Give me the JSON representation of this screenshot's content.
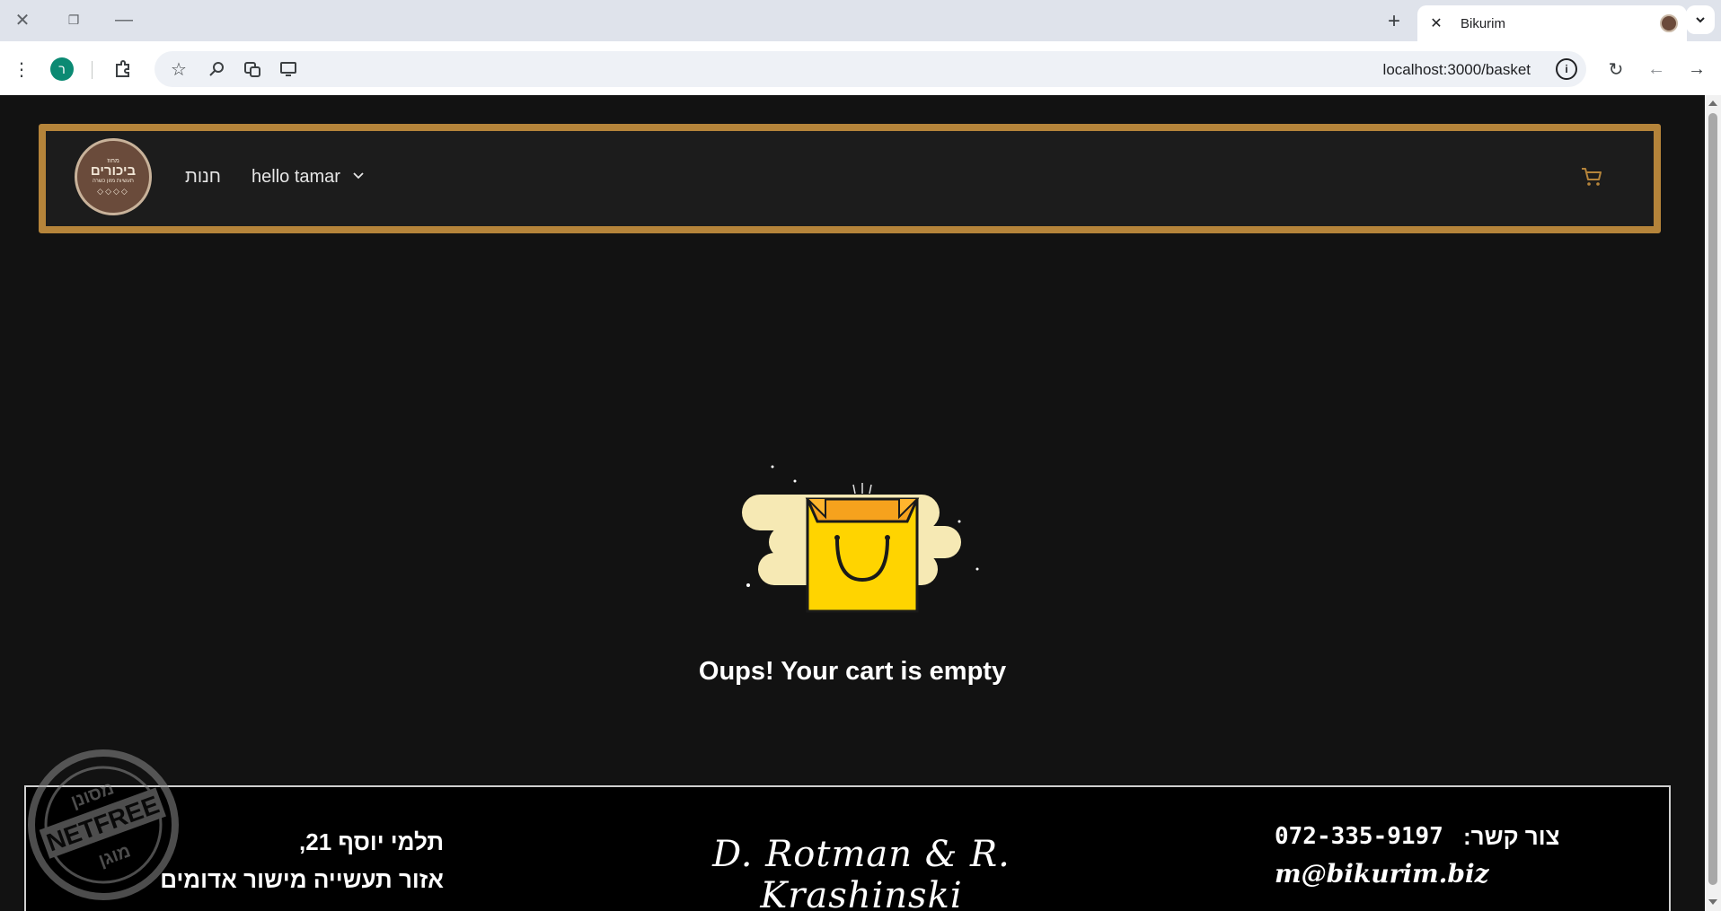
{
  "browser": {
    "tab_title": "Bikurim",
    "url": "localhost:3000/basket",
    "profile_initial": "ר",
    "icons": [
      "close-icon",
      "restore-icon",
      "minimize-icon",
      "new-tab-icon",
      "tab-list-icon",
      "menu-icon",
      "extensions-icon",
      "bookmark-star-icon",
      "zoom-icon",
      "translate-icon",
      "cast-icon",
      "info-icon",
      "reload-icon",
      "back-icon",
      "forward-icon"
    ]
  },
  "navbar": {
    "logo_top": "מחוז",
    "logo_main": "ביכורים",
    "logo_sub": "תעשיות מזון כשרה",
    "logo_symbols": "◇◇◇◇",
    "shop_link": "חנות",
    "user_menu": "hello tamar"
  },
  "main": {
    "empty_message": "Oups! Your cart is empty"
  },
  "watermark": {
    "top": "מסונן",
    "middle": "NETFREE",
    "bottom": "מוגן"
  },
  "footer": {
    "address_line1": "תלמי יוסף 21,",
    "address_line2": "אזור תעשייה מישור אדומים",
    "signature": "D. Rotman & R. Krashinski",
    "contact_label": "צור קשר:",
    "phone": "072-335-9197",
    "email": "m@bikurim.biz"
  },
  "colors": {
    "page_bg": "#121212",
    "navbar_border": "#b5843a",
    "accent": "#b5843a",
    "bag_yellow": "#ffd400",
    "bag_orange": "#f6a21d"
  }
}
